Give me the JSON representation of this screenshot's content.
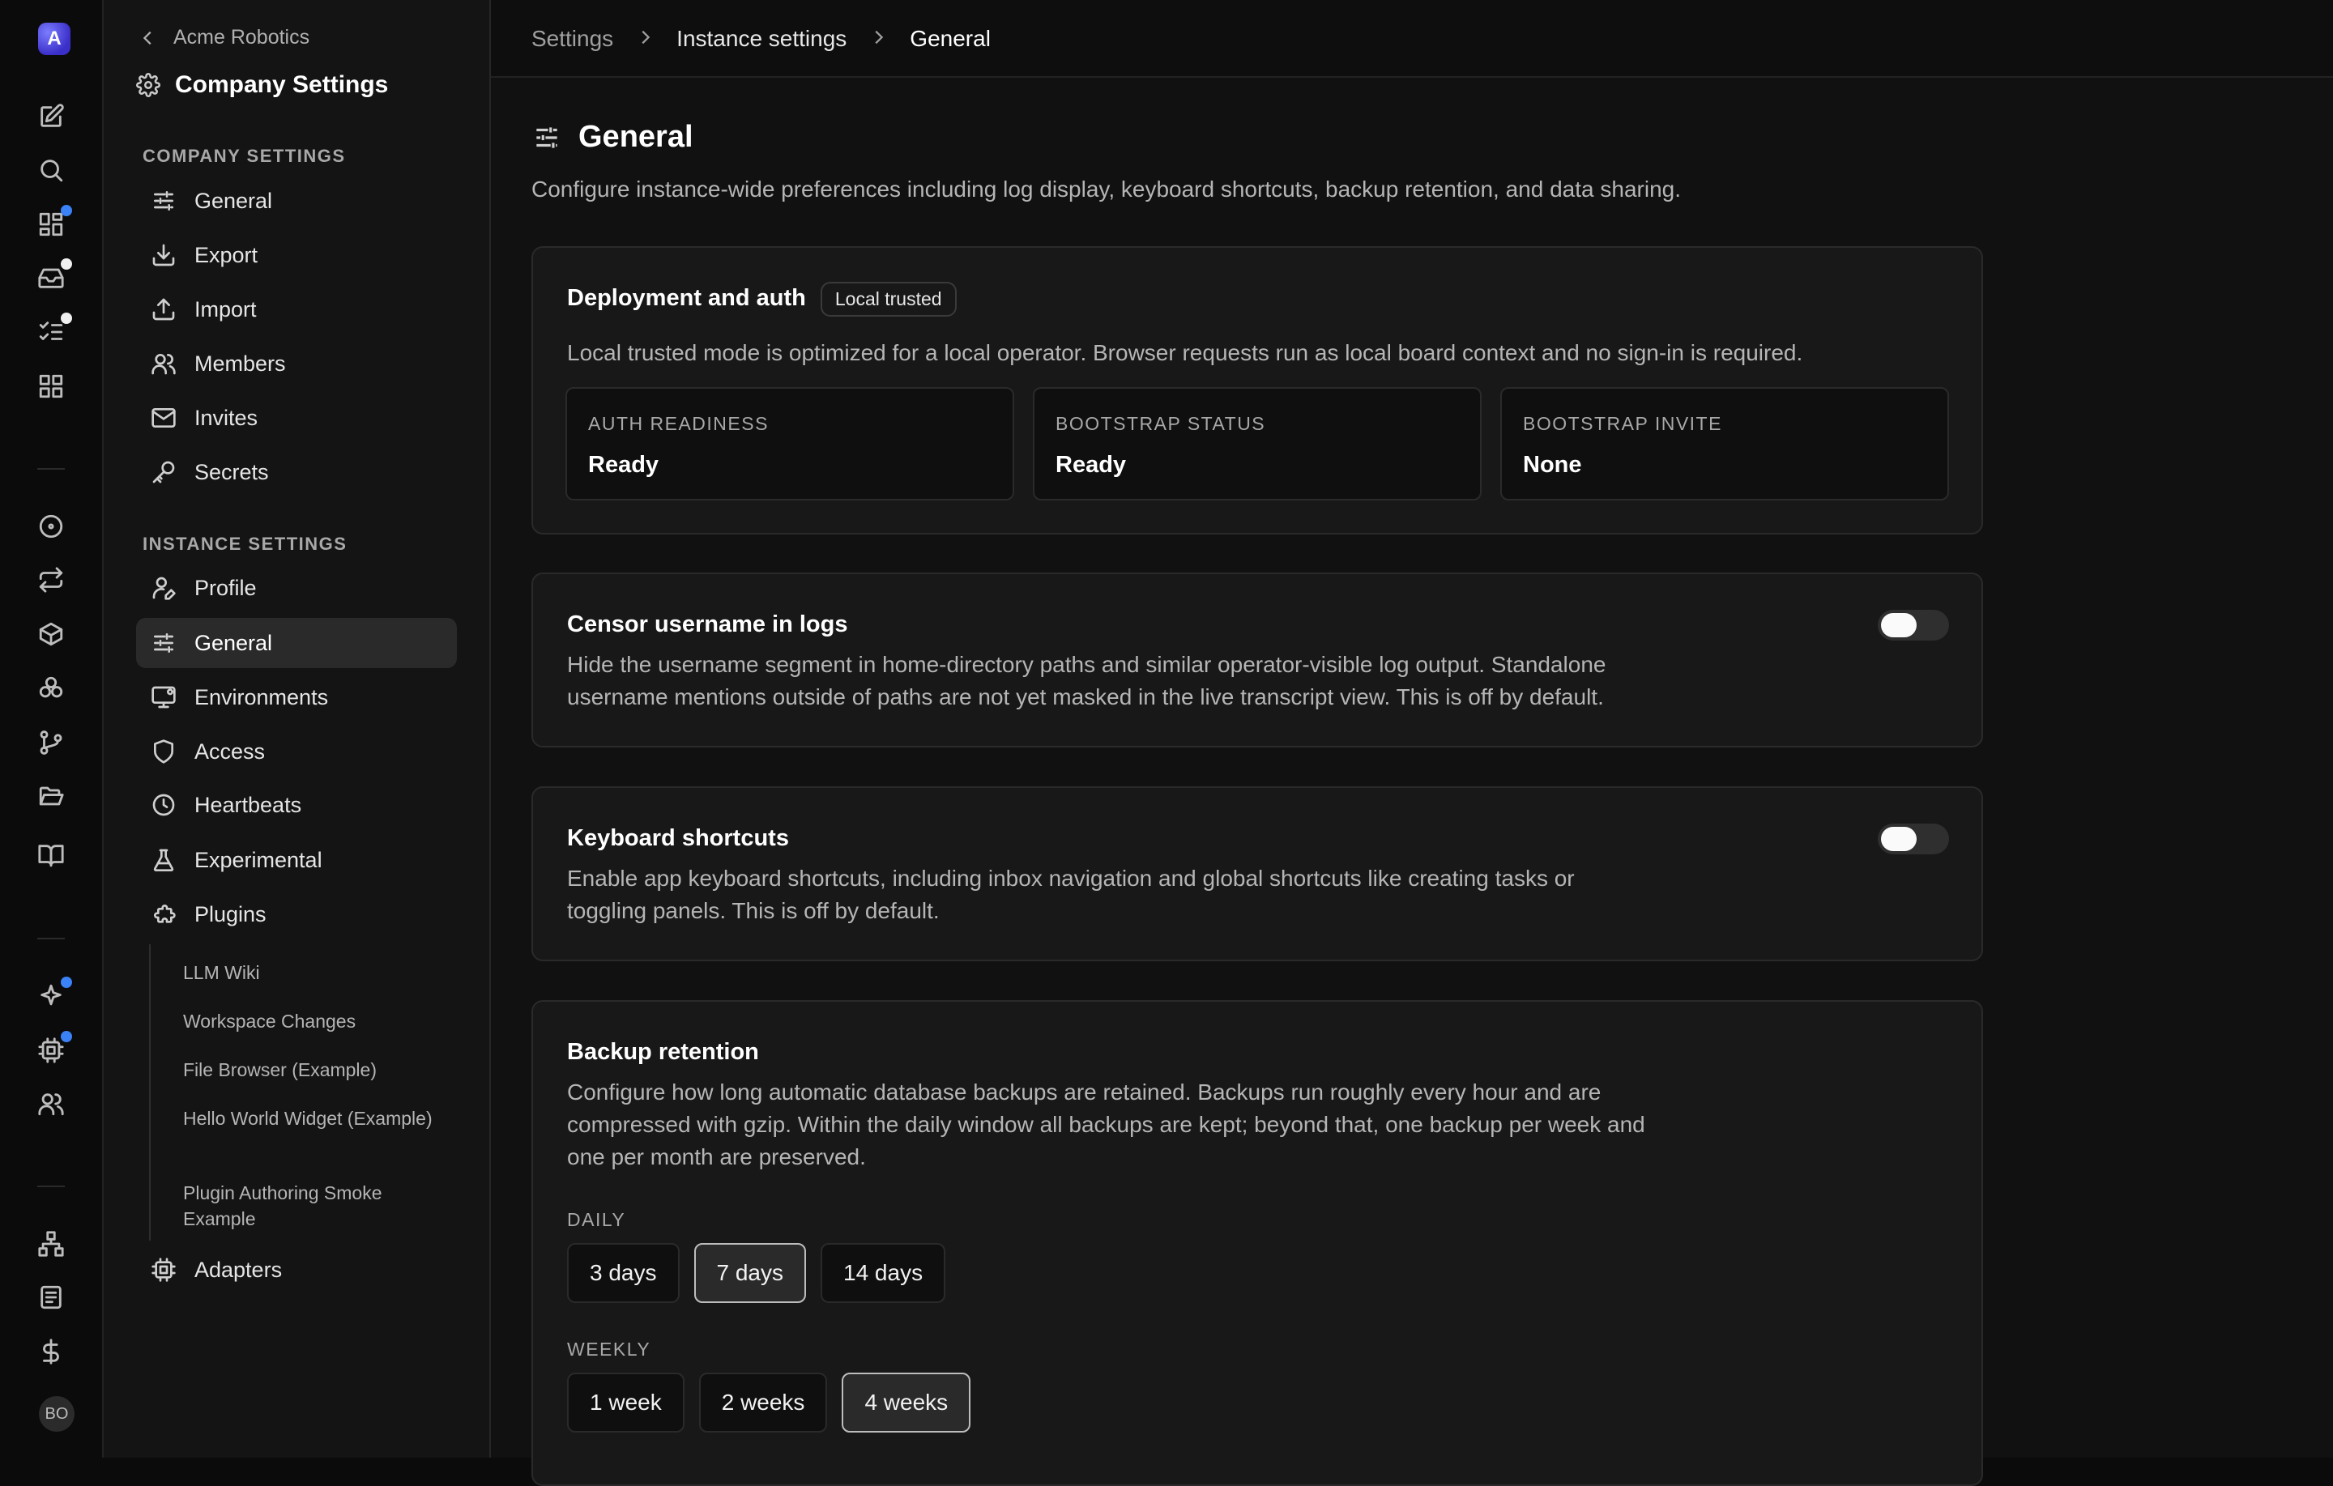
{
  "rail": {
    "logo_letter": "A",
    "avatar_initials": "BO"
  },
  "sidebar": {
    "back_label": "Acme Robotics",
    "title": "Company Settings",
    "company_section": "COMPANY SETTINGS",
    "company_items": [
      {
        "label": "General",
        "icon": "sliders-icon"
      },
      {
        "label": "Export",
        "icon": "download-icon"
      },
      {
        "label": "Import",
        "icon": "upload-icon"
      },
      {
        "label": "Members",
        "icon": "users-icon"
      },
      {
        "label": "Invites",
        "icon": "mail-icon"
      },
      {
        "label": "Secrets",
        "icon": "key-icon"
      }
    ],
    "instance_section": "INSTANCE SETTINGS",
    "instance_items": [
      {
        "label": "Profile",
        "icon": "user-pen-icon"
      },
      {
        "label": "General",
        "icon": "sliders-icon",
        "active": true
      },
      {
        "label": "Environments",
        "icon": "monitor-icon"
      },
      {
        "label": "Access",
        "icon": "shield-icon"
      },
      {
        "label": "Heartbeats",
        "icon": "clock-icon"
      },
      {
        "label": "Experimental",
        "icon": "flask-icon"
      },
      {
        "label": "Plugins",
        "icon": "puzzle-icon"
      }
    ],
    "plugins": [
      "LLM Wiki",
      "Workspace Changes",
      "File Browser (Example)",
      "Hello World Widget (Example)",
      "Plugin Authoring Smoke Example"
    ],
    "adapters_label": "Adapters"
  },
  "breadcrumb": {
    "root": "Settings",
    "mid": "Instance settings",
    "current": "General"
  },
  "page": {
    "title": "General",
    "description": "Configure instance-wide preferences including log display, keyboard shortcuts, backup retention, and data sharing."
  },
  "deployment": {
    "title": "Deployment and auth",
    "badge": "Local trusted",
    "description": "Local trusted mode is optimized for a local operator. Browser requests run as local board context and no sign-in is required.",
    "stats": [
      {
        "label": "AUTH READINESS",
        "value": "Ready"
      },
      {
        "label": "BOOTSTRAP STATUS",
        "value": "Ready"
      },
      {
        "label": "BOOTSTRAP INVITE",
        "value": "None"
      }
    ]
  },
  "censor": {
    "title": "Censor username in logs",
    "description": "Hide the username segment in home-directory paths and similar operator-visible log output. Standalone username mentions outside of paths are not yet masked in the live transcript view. This is off by default.",
    "enabled": false
  },
  "shortcuts": {
    "title": "Keyboard shortcuts",
    "description": "Enable app keyboard shortcuts, including inbox navigation and global shortcuts like creating tasks or toggling panels. This is off by default.",
    "enabled": false
  },
  "backup": {
    "title": "Backup retention",
    "description": "Configure how long automatic database backups are retained. Backups run roughly every hour and are compressed with gzip. Within the daily window all backups are kept; beyond that, one backup per week and one per month are preserved.",
    "daily_label": "DAILY",
    "daily_options": [
      "3 days",
      "7 days",
      "14 days"
    ],
    "daily_selected": "7 days",
    "weekly_label": "WEEKLY",
    "weekly_options": [
      "1 week",
      "2 weeks",
      "4 weeks"
    ],
    "weekly_selected": "4 weeks"
  },
  "colors": {
    "accent_dot": "#3b82f6",
    "active_bg": "#2a2a2a",
    "card_bg": "#181818"
  }
}
